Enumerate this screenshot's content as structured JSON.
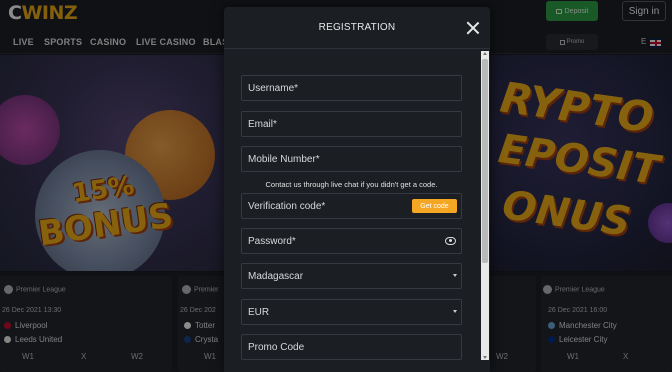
{
  "header": {
    "logo_text_c": "C",
    "logo_text_rest": "WINZ",
    "deposit_label": "Deposit",
    "signin_label": "Sign in"
  },
  "nav": {
    "items": [
      "LIVE",
      "SPORTS",
      "CASINO",
      "LIVE CASINO",
      "BLAS"
    ],
    "promo_label": "Promo",
    "lang_letter": "E"
  },
  "banners": {
    "left_bonus_line1": "15%",
    "left_bonus_line2": "BONUS",
    "right_line1": "RYPTO",
    "right_line2": "EPOSIT",
    "right_line3": "ONUS"
  },
  "matches": [
    {
      "league": "Premier League",
      "date": "26 Dec 2021 13:30",
      "team1": "Liverpool",
      "team2": "Leeds United",
      "odds_labels": [
        "W1",
        "X",
        "W2"
      ]
    },
    {
      "league": "Premier",
      "date": "26 Dec 202",
      "team1": "Totter",
      "team2": "Crysta",
      "odds_labels": [
        "W1"
      ]
    },
    {
      "league": "",
      "date": "",
      "team1": "",
      "team2": "",
      "odds_labels": [
        "W2"
      ]
    },
    {
      "league": "Premier League",
      "date": "26 Dec 2021 16:00",
      "team1": "Manchester City",
      "team2": "Leicester City",
      "odds_labels": [
        "W1",
        "X"
      ]
    }
  ],
  "modal": {
    "title": "REGISTRATION",
    "fields": {
      "username": "Username*",
      "email": "Email*",
      "mobile": "Mobile Number*",
      "hint": "Contact us through live chat if you didn't get a code.",
      "verification": "Verification code*",
      "get_code": "Get code",
      "password": "Password*",
      "country": "Madagascar",
      "currency": "EUR",
      "promo": "Promo Code"
    }
  },
  "colors": {
    "accent": "#f5a623",
    "deposit_green": "#2fa34a",
    "modal_bg": "#1b1e23"
  }
}
